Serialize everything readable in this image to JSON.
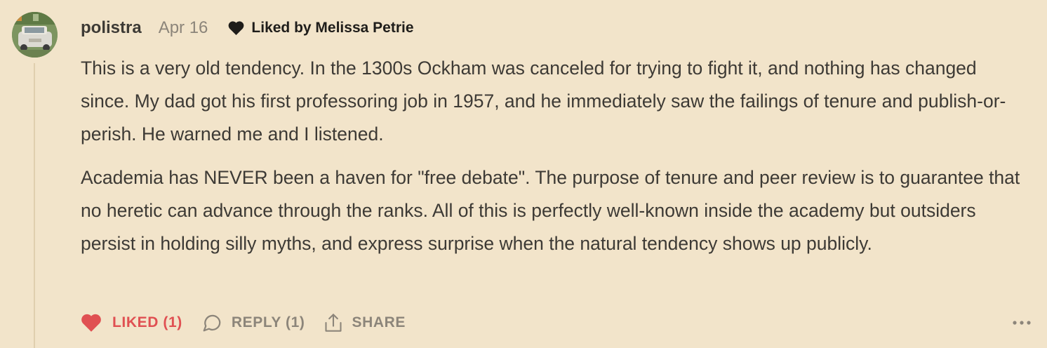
{
  "comment": {
    "username": "polistra",
    "date": "Apr 16",
    "liked_by": "Liked by Melissa Petrie",
    "paragraphs": [
      "This is a very old tendency. In the 1300s Ockham was canceled for trying to fight it, and nothing has changed since. My dad got his first professoring job in 1957, and he immediately saw the failings of tenure and publish-or-perish. He warned me and I listened.",
      "Academia has NEVER been a haven for \"free debate\". The purpose of tenure and peer review is to guarantee that no heretic can advance through the ranks. All of this is perfectly well-known inside the academy but outsiders persist in holding silly myths, and express surprise when the natural tendency shows up publicly."
    ]
  },
  "actions": {
    "like_label": "LIKED (1)",
    "reply_label": "REPLY (1)",
    "share_label": "SHARE"
  },
  "icons": {
    "avatar": "avatar-photo-car",
    "liked_by": "heart-icon",
    "like": "heart-filled-icon",
    "reply": "speech-bubble-icon",
    "share": "share-upload-icon",
    "more": "ellipsis-icon"
  },
  "colors": {
    "background": "#f2e4ca",
    "text": "#3d3a35",
    "muted": "#8c857a",
    "liked": "#e05052"
  }
}
